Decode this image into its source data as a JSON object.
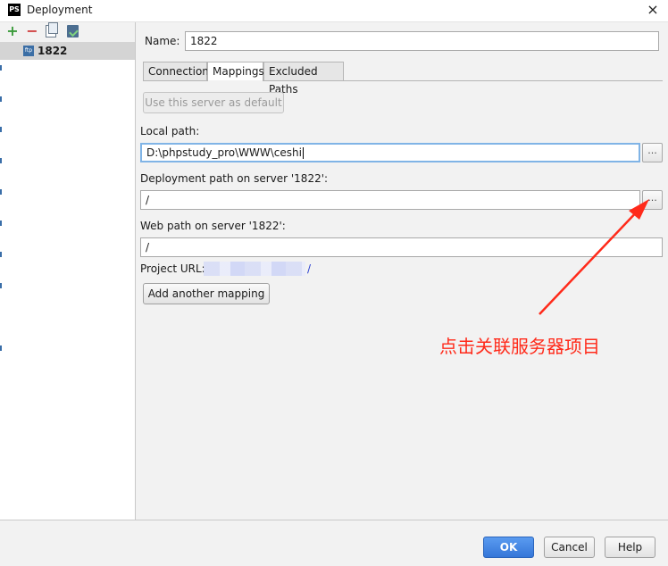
{
  "window": {
    "title": "Deployment",
    "app_icon": "PS",
    "close_label": "×"
  },
  "sidebar": {
    "toolbar": {
      "add": "+",
      "remove": "−"
    },
    "servers": [
      {
        "label": "1822",
        "icon_text": "ftp"
      }
    ]
  },
  "form": {
    "name_label": "Name:",
    "name_value": "1822",
    "tabs": [
      {
        "label": "Connection",
        "active": false
      },
      {
        "label": "Mappings",
        "active": true
      },
      {
        "label": "Excluded Paths",
        "active": false
      }
    ],
    "default_server_button": "Use this server as default",
    "local_path_label": "Local path:",
    "local_path_value": "D:\\phpstudy_pro\\WWW\\ceshi",
    "deployment_path_label": "Deployment path on server '1822':",
    "deployment_path_value": "/",
    "web_path_label": "Web path on server '1822':",
    "web_path_value": "/",
    "project_url_label": "Project URL:",
    "project_url_tail": "/",
    "add_mapping_button": "Add another mapping",
    "browse_label": "..."
  },
  "annotation": {
    "text": "点击关联服务器项目",
    "color": "#ff2a1a"
  },
  "buttons": {
    "ok": "OK",
    "cancel": "Cancel",
    "help": "Help"
  },
  "colors": {
    "ok_button": "#3576d8",
    "focus_border": "#80b4e6"
  }
}
